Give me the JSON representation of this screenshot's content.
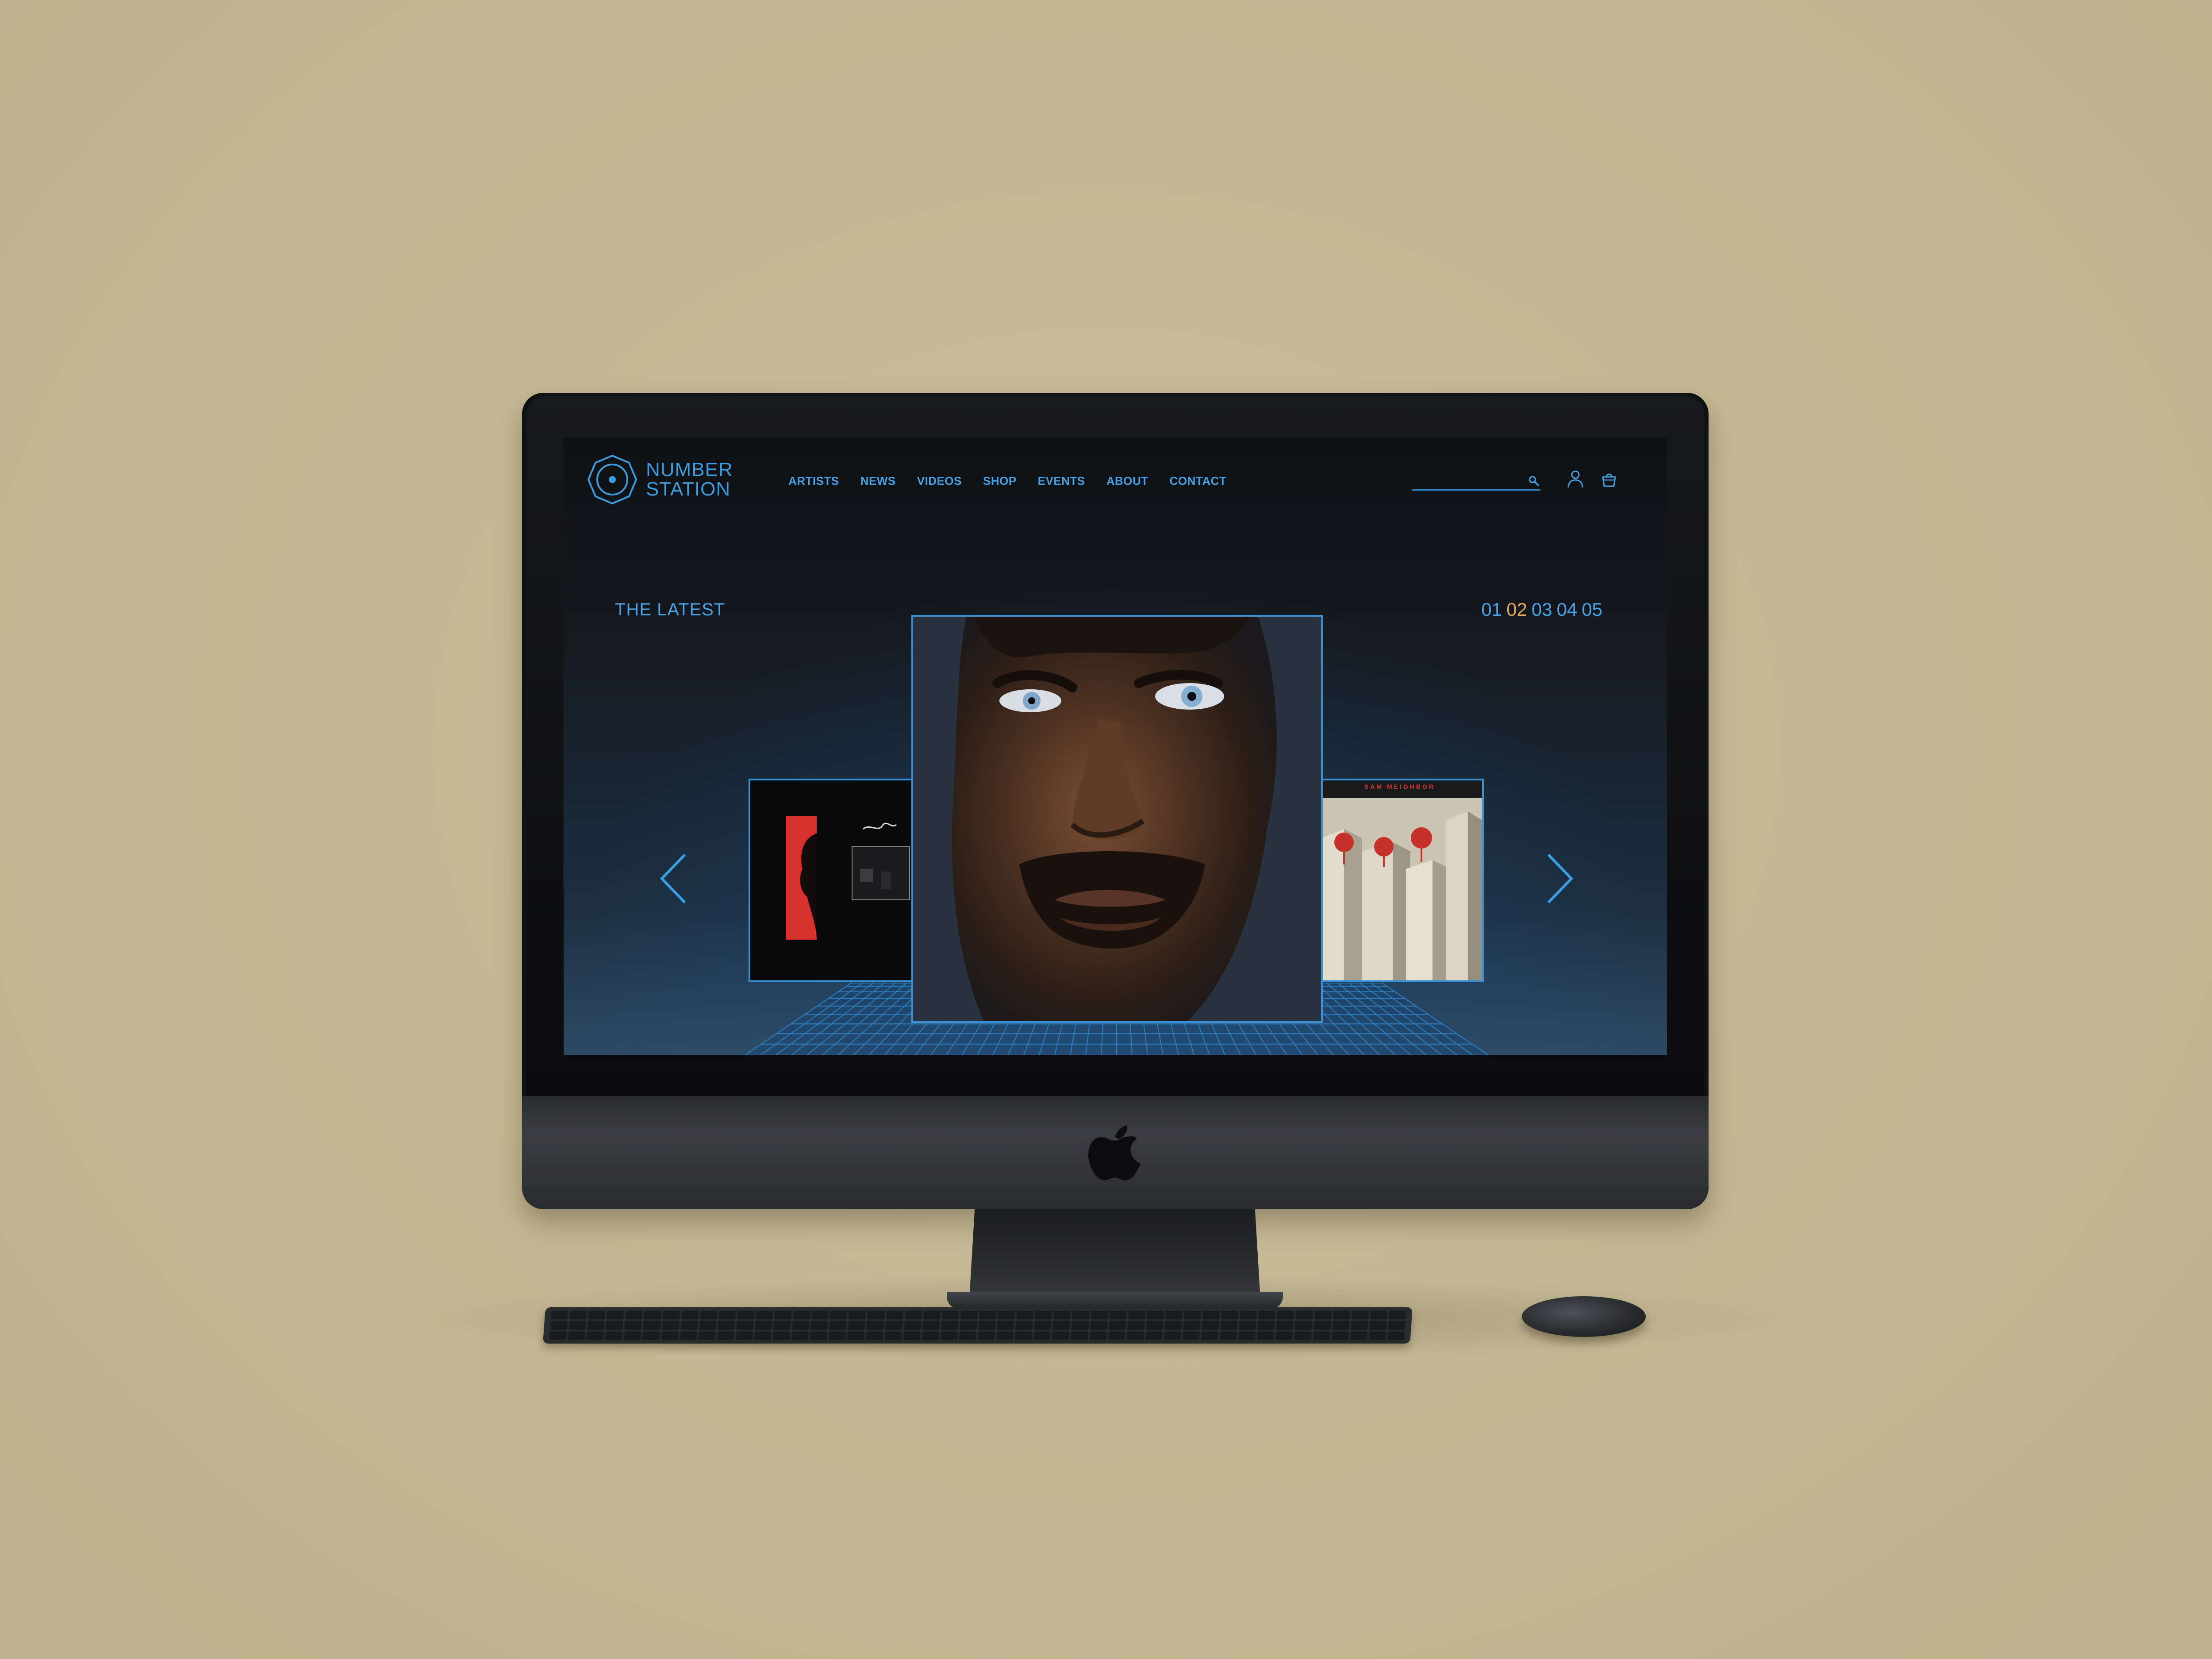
{
  "brand": {
    "line1": "NUMBER",
    "line2": "STATION",
    "logo_icon": "vinyl-octagon-icon"
  },
  "nav": {
    "items": [
      {
        "label": "ARTISTS"
      },
      {
        "label": "NEWS"
      },
      {
        "label": "VIDEOS"
      },
      {
        "label": "SHOP"
      },
      {
        "label": "EVENTS"
      },
      {
        "label": "ABOUT"
      },
      {
        "label": "CONTACT"
      }
    ]
  },
  "header": {
    "search": {
      "value": "",
      "placeholder": "",
      "icon": "search-icon"
    },
    "account_icon": "user-icon",
    "cart_icon": "shopping-bag-icon"
  },
  "hero": {
    "title": "THE LATEST",
    "pager": [
      "01",
      "02",
      "03",
      "04",
      "05"
    ],
    "active_page": "02",
    "prev_icon": "chevron-left-icon",
    "next_icon": "chevron-right-icon",
    "right_album_text": "SAM MEIGHBOR"
  },
  "colors": {
    "accent": "#4aa3e6",
    "active_page": "#e0a85a",
    "background_top": "#0e1013",
    "background_bottom": "#2e4a63",
    "desk": "#c4b994"
  }
}
